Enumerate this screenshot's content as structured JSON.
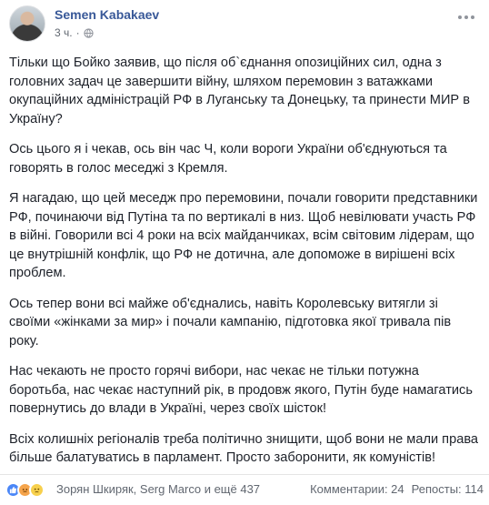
{
  "post": {
    "author": "Semen Kabakaev",
    "time": "3 ч.",
    "separator": "·",
    "paragraphs": [
      "Тільки що Бойко заявив, що після об`єднання опозиційних сил, одна з головних задач це завершити війну, шляхом перемовин з ватажками окупаційних адміністрацій РФ в Луганську та Донецьку, та принести МИР в Україну?",
      "Ось цього я і чекав, ось він час Ч, коли вороги України об'єднуються та говорять в голос меседжі з Кремля.",
      "Я нагадаю, що цей меседж про перемовини, почали говорити представники РФ, починаючи від Путіна та по вертикалі в низ. Щоб невілювати участь РФ в війні. Говорили всі 4 роки на всіх майданчиках, всім світовим лідерам, що це внутрішній конфлік, що РФ не дотична, але допоможе в вирішені всіх проблем.",
      "Ось тепер вони всі майже об'єднались, навіть Королевську витягли зі своїми «жінками за мир» і почали кампанію, підготовка якої тривала пів року.",
      "Нас чекають не просто горячі вибори, нас чекає не тільки потужна боротьба, нас чекає наступний рік, в продовж якого, Путін буде намагатись повернутись до влади в Україні, через своїх шісток!",
      "Всіх колишніх регіоналів треба політично знищити, щоб вони не мали права більше балатуватись в парламент. Просто заборонити, як комуністів!"
    ]
  },
  "footer": {
    "reactors": "Зорян Шкиряк, Serg Marco и ещё 437",
    "comments": "Комментарии: 24",
    "shares": "Репосты: 114"
  },
  "icons": {
    "privacy": "globe-icon",
    "menu": "more-icon",
    "reactions": [
      "like-icon",
      "angry-icon",
      "sad-icon"
    ]
  },
  "colors": {
    "author_link": "#385898",
    "text": "#1d2129",
    "muted": "#606770"
  }
}
